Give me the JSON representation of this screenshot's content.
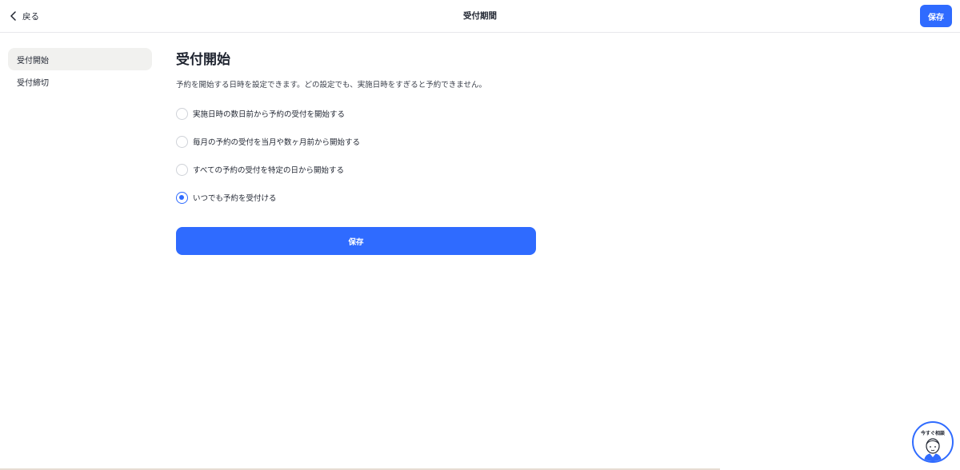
{
  "header": {
    "back_label": "戻る",
    "title": "受付期間",
    "save_label": "保存"
  },
  "sidebar": {
    "items": [
      {
        "label": "受付開始",
        "active": true
      },
      {
        "label": "受付締切",
        "active": false
      }
    ]
  },
  "main": {
    "section_title": "受付開始",
    "description": "予約を開始する日時を設定できます。どの設定でも、実施日時をすぎると予約できません。",
    "options": [
      {
        "label": "実施日時の数日前から予約の受付を開始する",
        "checked": false
      },
      {
        "label": "毎月の予約の受付を当月や数ヶ月前から開始する",
        "checked": false
      },
      {
        "label": "すべての予約の受付を特定の日から開始する",
        "checked": false
      },
      {
        "label": "いつでも予約を受付ける",
        "checked": true
      }
    ],
    "save_label": "保存"
  },
  "help_widget": {
    "label": "今すぐ相談"
  },
  "colors": {
    "accent": "#2f6bff",
    "sidebar_active_bg": "#f1f1ef",
    "text": "#1f2430"
  }
}
